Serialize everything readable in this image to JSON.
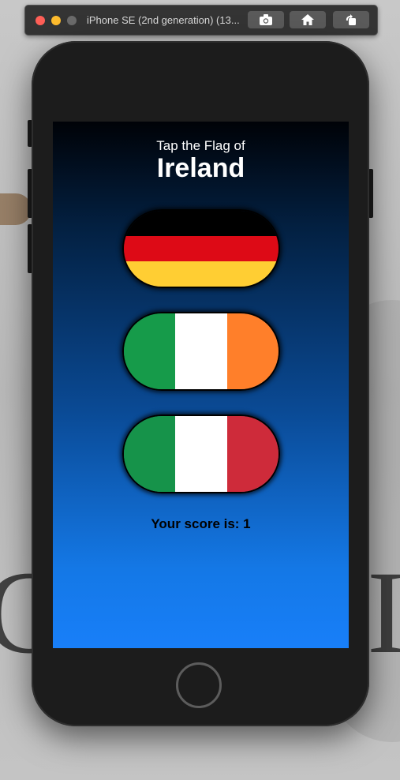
{
  "window": {
    "title": "iPhone SE (2nd generation) (13..."
  },
  "toolbar": {
    "screenshot_icon": "camera-icon",
    "home_icon": "home-icon",
    "rotate_icon": "rotate-icon"
  },
  "app": {
    "prompt": "Tap the Flag of",
    "country": "Ireland",
    "score_text": "Your score is: 1",
    "flags": [
      {
        "name": "Germany",
        "orientation": "horizontal",
        "colors": [
          "#000000",
          "#dd0a16",
          "#ffce33"
        ]
      },
      {
        "name": "Ireland",
        "orientation": "vertical",
        "colors": [
          "#169b4a",
          "#ffffff",
          "#ff7f2a"
        ]
      },
      {
        "name": "Italy",
        "orientation": "vertical",
        "colors": [
          "#16934a",
          "#ffffff",
          "#ce2b3a"
        ]
      }
    ]
  },
  "background": {
    "left_glyph": "C",
    "right_glyph": "I"
  }
}
